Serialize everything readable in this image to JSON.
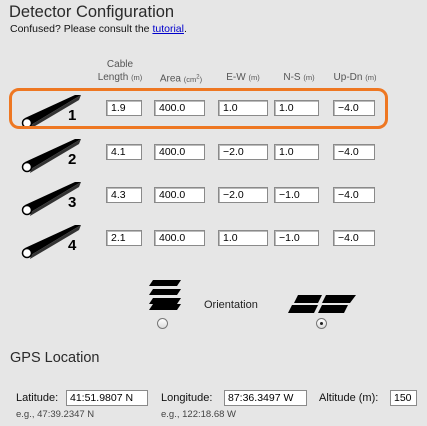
{
  "page": {
    "title": "Detector Configuration",
    "subtitle_prefix": "Confused? Please consult the ",
    "subtitle_link": "tutorial",
    "subtitle_suffix": "."
  },
  "columns": {
    "cable_top": "Cable",
    "length": "Length",
    "unit_m": "(m)",
    "area": "Area",
    "area_unit_base": "(cm",
    "area_unit_exp": "2",
    "area_unit_close": ")",
    "ew": "E-W",
    "ns": "N-S",
    "updn": "Up-Dn"
  },
  "detectors": [
    {
      "number": "1",
      "length": "1.9",
      "area": "400.0",
      "ew": "1.0",
      "ns": "1.0",
      "updn": "−4.0"
    },
    {
      "number": "2",
      "length": "4.1",
      "area": "400.0",
      "ew": "−2.0",
      "ns": "1.0",
      "updn": "−4.0"
    },
    {
      "number": "3",
      "length": "4.3",
      "area": "400.0",
      "ew": "−2.0",
      "ns": "−1.0",
      "updn": "−4.0"
    },
    {
      "number": "4",
      "length": "2.1",
      "area": "400.0",
      "ew": "1.0",
      "ns": "−1.0",
      "updn": "−4.0"
    }
  ],
  "highlight_color": "#ee7722",
  "orientation": {
    "label": "Orientation",
    "selected": "flat",
    "options": [
      "stacked-icon",
      "flat-icon"
    ]
  },
  "gps": {
    "title": "GPS Location",
    "latitude_label": "Latitude:",
    "latitude_value": "41:51.9807 N",
    "latitude_example": "e.g., 47:39.2347 N",
    "longitude_label": "Longitude:",
    "longitude_value": "87:36.3497 W",
    "longitude_example": "e.g., 122:18.68 W",
    "altitude_label": "Altitude (m):",
    "altitude_value": "150"
  }
}
